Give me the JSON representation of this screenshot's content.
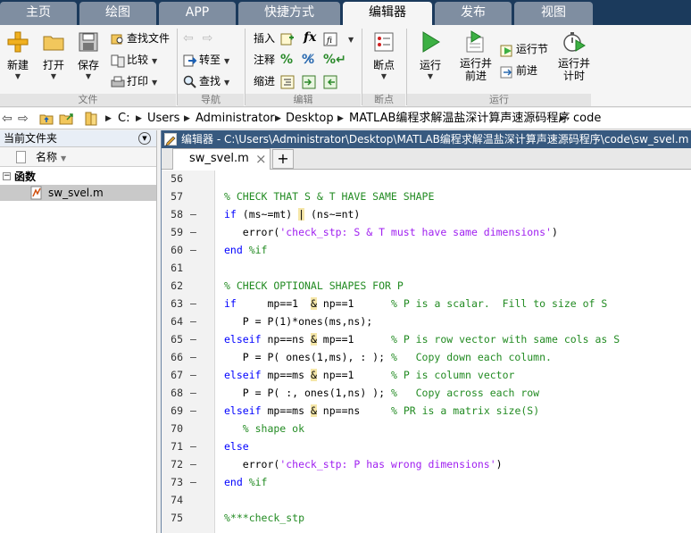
{
  "tabs": [
    {
      "label": "主页"
    },
    {
      "label": "绘图"
    },
    {
      "label": "APP"
    },
    {
      "label": "快捷方式"
    },
    {
      "label": "编辑器"
    },
    {
      "label": "发布"
    },
    {
      "label": "视图"
    }
  ],
  "ribbon": {
    "file": {
      "group_label": "文件",
      "new": "新建",
      "open": "打开",
      "save": "保存",
      "find_files": "查找文件",
      "compare": "比较",
      "print": "打印"
    },
    "navigate": {
      "group_label": "导航",
      "goto": "转至",
      "find": "查找"
    },
    "edit": {
      "group_label": "编辑",
      "insert": "插入",
      "comment": "注释",
      "indent": "缩进",
      "fx": "fx"
    },
    "breakpoints": {
      "group_label": "断点",
      "breakpoint": "断点"
    },
    "run": {
      "group_label": "运行",
      "run": "运行",
      "run_and_advance_1": "运行并",
      "run_and_advance_2": "前进",
      "run_section": "运行节",
      "advance": "前进",
      "run_and_time_1": "运行并",
      "run_and_time_2": "计时"
    }
  },
  "address": {
    "crumbs": [
      "C:",
      "Users",
      "Administrator",
      "Desktop",
      "MATLAB编程求解温盐深计算声速源码程序",
      "code"
    ]
  },
  "left_panel": {
    "title": "当前文件夹",
    "column_name": "名称",
    "group": "函数",
    "file": "sw_svel.m"
  },
  "editor": {
    "title": "编辑器 - C:\\Users\\Administrator\\Desktop\\MATLAB编程求解温盐深计算声速源码程序\\code\\sw_svel.m",
    "tab_label": "sw_svel.m",
    "close_glyph": "×",
    "add_glyph": "+",
    "lines": [
      {
        "num": "56",
        "dash": ""
      },
      {
        "num": "57",
        "dash": ""
      },
      {
        "num": "58",
        "dash": "–"
      },
      {
        "num": "59",
        "dash": "–"
      },
      {
        "num": "60",
        "dash": "–"
      },
      {
        "num": "61",
        "dash": ""
      },
      {
        "num": "62",
        "dash": ""
      },
      {
        "num": "63",
        "dash": "–"
      },
      {
        "num": "64",
        "dash": "–"
      },
      {
        "num": "65",
        "dash": "–"
      },
      {
        "num": "66",
        "dash": "–"
      },
      {
        "num": "67",
        "dash": "–"
      },
      {
        "num": "68",
        "dash": "–"
      },
      {
        "num": "69",
        "dash": "–"
      },
      {
        "num": "70",
        "dash": ""
      },
      {
        "num": "71",
        "dash": "–"
      },
      {
        "num": "72",
        "dash": "–"
      },
      {
        "num": "73",
        "dash": "–"
      },
      {
        "num": "74",
        "dash": ""
      },
      {
        "num": "75",
        "dash": ""
      }
    ],
    "code": {
      "l57": "% CHECK THAT S & T HAVE SAME SHAPE",
      "l58a": "if",
      "l58b": " (ms~=mt) ",
      "l58c": "|",
      "l58d": " (ns~=nt)",
      "l59a": "   error(",
      "l59b": "'check_stp: S & T must have same dimensions'",
      "l59c": ")",
      "l60a": "end",
      "l60b": " %if",
      "l62": "% CHECK OPTIONAL SHAPES FOR P",
      "l63a": "if",
      "l63b": "     mp==1  ",
      "l63c": "&",
      "l63d": " np==1      ",
      "l63e": "% P is a scalar.  Fill to size of S",
      "l64": "   P = P(1)*ones(ms,ns);",
      "l65a": "elseif",
      "l65b": " np==ns ",
      "l65c": "&",
      "l65d": " mp==1      ",
      "l65e": "% P is row vector with same cols as S",
      "l66a": "   P = P( ones(1,ms), : ); ",
      "l66b": "%   Copy down each column.",
      "l67a": "elseif",
      "l67b": " mp==ms ",
      "l67c": "&",
      "l67d": " np==1      ",
      "l67e": "% P is column vector",
      "l68a": "   P = P( :, ones(1,ns) ); ",
      "l68b": "%   Copy across each row",
      "l69a": "elseif",
      "l69b": " mp==ms ",
      "l69c": "&",
      "l69d": " np==ns     ",
      "l69e": "% PR is a matrix size(S)",
      "l70": "   % shape ok",
      "l71": "else",
      "l72a": "   error(",
      "l72b": "'check_stp: P has wrong dimensions'",
      "l72c": ")",
      "l73a": "end",
      "l73b": " %if",
      "l75": "%***check_stp"
    }
  }
}
